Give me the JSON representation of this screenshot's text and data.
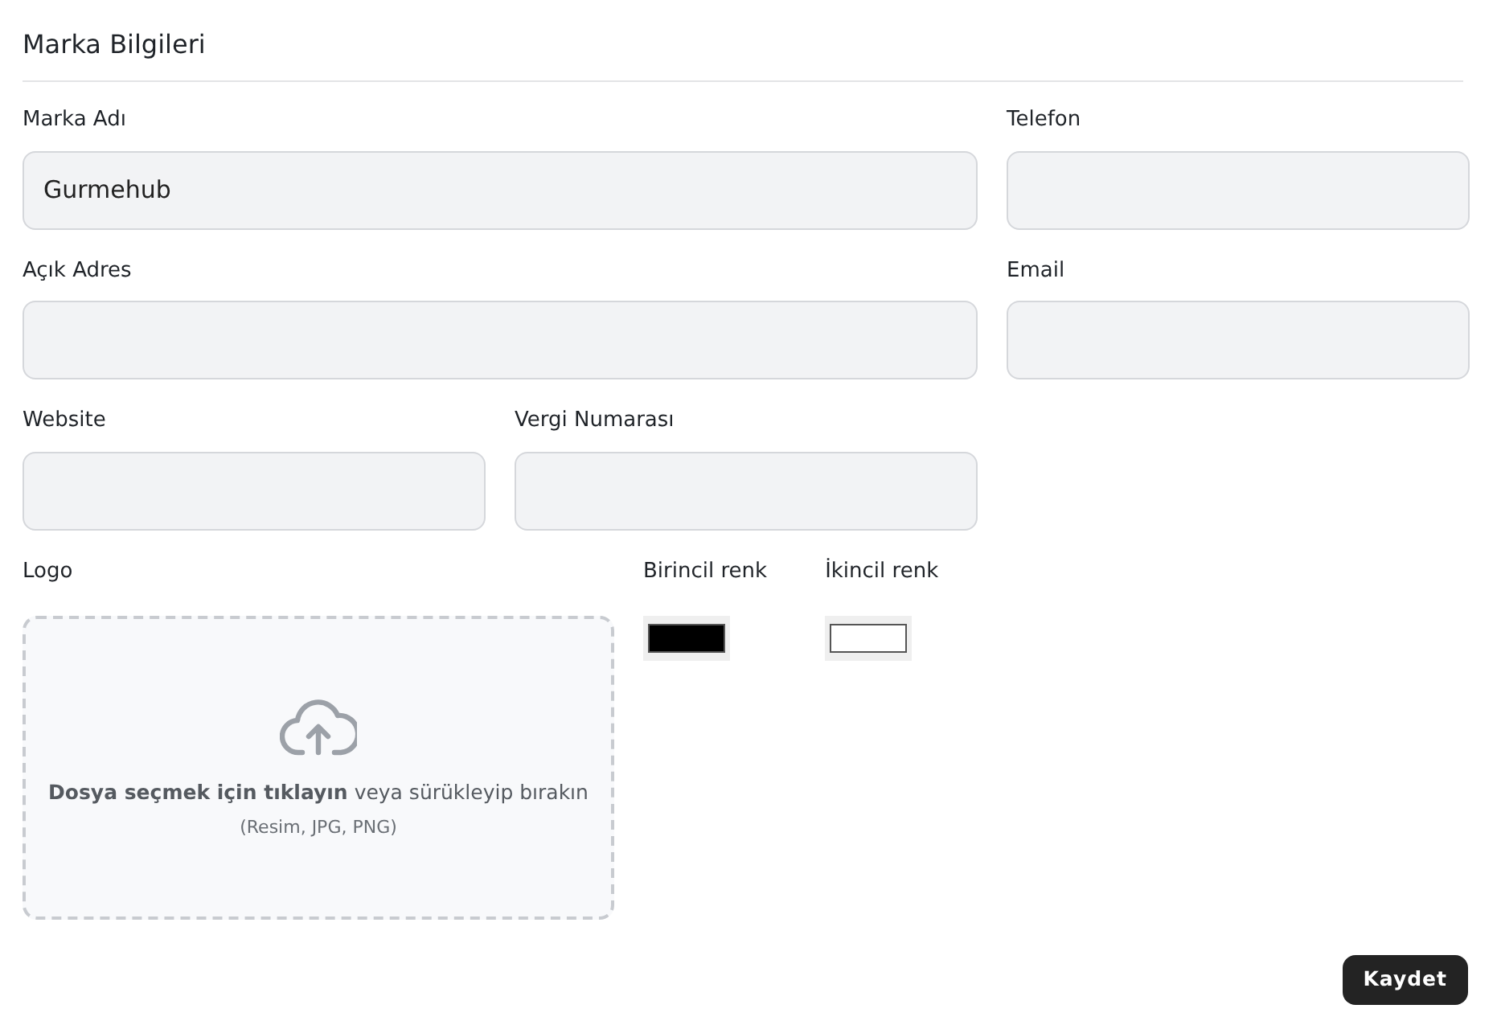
{
  "section_title": "Marka Bilgileri",
  "fields": [
    {
      "label": "Marka Adı",
      "value": "Gurmehub",
      "wide": true
    },
    {
      "label": "Telefon",
      "wide": false
    },
    {
      "label": "Açık Adres",
      "wide": true
    },
    {
      "label": "Email",
      "wide": false
    },
    {
      "label": "Website",
      "wide": false
    },
    {
      "label": "Vergi Numarası",
      "wide": false
    }
  ],
  "logo": {
    "label": "Logo",
    "instruction": "**Dosya seçmek için tıklayın** veya sürükleyip bırakın",
    "formats": "(Resim, JPG, PNG)"
  },
  "colors": [
    {
      "label": "Birincil renk",
      "color": "#000000"
    },
    {
      "label": "İkincil renk",
      "color": "#ffffff"
    }
  ],
  "save_button": "Kaydet"
}
